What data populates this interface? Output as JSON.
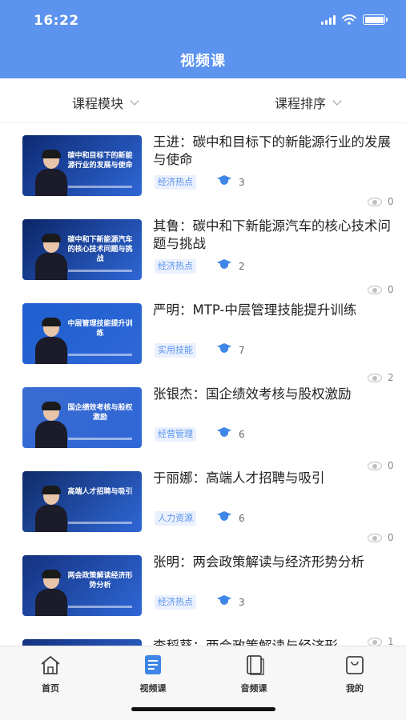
{
  "status_bar": {
    "time": "16:22"
  },
  "header": {
    "title": "视频课"
  },
  "filters": {
    "module": "课程模块",
    "sort": "课程排序"
  },
  "courses": [
    {
      "title": "王进：碳中和目标下的新能源行业的发展与使命",
      "tag": "经济热点",
      "learners": "3",
      "views": "0",
      "thumb_text": "碳中和目标下的新能源行业的发展与使命",
      "thumb_bg": "#0d2a73"
    },
    {
      "title": "其鲁：碳中和下新能源汽车的核心技术问题与挑战",
      "tag": "经济热点",
      "learners": "2",
      "views": "0",
      "thumb_text": "碳中和下新能源汽车的核心技术问题与挑战",
      "thumb_bg": "#0b2567"
    },
    {
      "title": "严明：MTP-中层管理技能提升训练",
      "tag": "实用技能",
      "learners": "7",
      "views": "2",
      "thumb_text": "中层管理技能提升训练",
      "thumb_bg": "#1e5fcf"
    },
    {
      "title": "张银杰：国企绩效考核与股权激励",
      "tag": "经营管理",
      "learners": "6",
      "views": "0",
      "thumb_text": "国企绩效考核与股权激励",
      "thumb_bg": "#3a6bd1"
    },
    {
      "title": "于丽娜：高端人才招聘与吸引",
      "tag": "人力资源",
      "learners": "6",
      "views": "0",
      "thumb_text": "高端人才招聘与吸引",
      "thumb_bg": "#102c6a"
    },
    {
      "title": "张明：两会政策解读与经济形势分析",
      "tag": "经济热点",
      "learners": "3",
      "views": "1",
      "thumb_text": "两会政策解读经济形势分析",
      "thumb_bg": "#14327f"
    },
    {
      "title": "李稻葵：两会政策解读与经济形",
      "tag": "",
      "learners": "",
      "views": "",
      "thumb_text": "",
      "thumb_bg": "#14327f"
    }
  ],
  "tabbar": {
    "items": [
      {
        "label": "首页",
        "icon": "home-icon"
      },
      {
        "label": "视频课",
        "icon": "video-doc-icon"
      },
      {
        "label": "音频课",
        "icon": "book-icon"
      },
      {
        "label": "我的",
        "icon": "bag-icon"
      }
    ],
    "active_color": "#3f86e6"
  },
  "colors": {
    "header": "#5b93ee",
    "accent": "#3f86e6"
  }
}
